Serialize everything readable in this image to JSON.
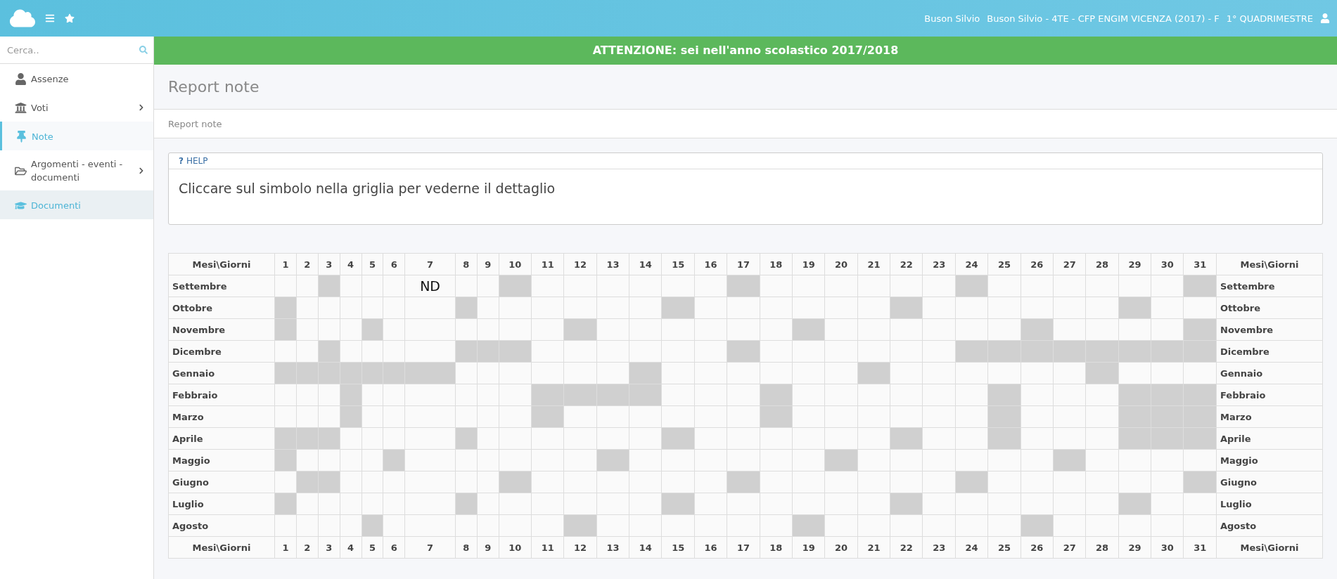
{
  "topbar": {
    "user_name": "Buson Silvio",
    "class_info": "Buson Silvio - 4TE - CFP ENGIM VICENZA (2017) - F",
    "period": "1° QUADRIMESTRE"
  },
  "sidebar": {
    "search": {
      "placeholder": "Cerca.."
    },
    "items": [
      {
        "label": "Assenze",
        "selected": false,
        "has_submenu": false
      },
      {
        "label": "Voti",
        "selected": false,
        "has_submenu": true
      },
      {
        "label": "Note",
        "selected": true,
        "has_submenu": false
      },
      {
        "label": "Argomenti - eventi - documenti",
        "selected": false,
        "has_submenu": true
      },
      {
        "label": "Documenti",
        "selected": false,
        "hovered": true,
        "has_submenu": false
      }
    ]
  },
  "banner": "ATTENZIONE: sei nell'anno scolastico 2017/2018",
  "page_title": "Report note",
  "breadcrumb": "Report note",
  "help": {
    "title": "HELP",
    "icon_text": "?",
    "text": "Cliccare sul simbolo nella griglia per vederne il dettaglio"
  },
  "grid": {
    "header": [
      "Mesi\\Giorni",
      "1",
      "2",
      "3",
      "4",
      "5",
      "6",
      "7",
      "8",
      "9",
      "10",
      "11",
      "12",
      "13",
      "14",
      "15",
      "16",
      "17",
      "18",
      "19",
      "20",
      "21",
      "22",
      "23",
      "24",
      "25",
      "26",
      "27",
      "28",
      "29",
      "30",
      "31",
      "Mesi\\Giorni"
    ],
    "rows": [
      {
        "month_left": "Settembre",
        "month_right": "Settembre",
        "cells": [
          {
            "closed": false
          },
          {
            "closed": false
          },
          {
            "closed": true
          },
          {
            "closed": false
          },
          {
            "closed": false
          },
          {
            "closed": false
          },
          {
            "closed": false,
            "text": "ND"
          },
          {
            "closed": false
          },
          {
            "closed": false
          },
          {
            "closed": true
          },
          {
            "closed": false
          },
          {
            "closed": false
          },
          {
            "closed": false
          },
          {
            "closed": false
          },
          {
            "closed": false
          },
          {
            "closed": false
          },
          {
            "closed": true
          },
          {
            "closed": false
          },
          {
            "closed": false
          },
          {
            "closed": false
          },
          {
            "closed": false
          },
          {
            "closed": false
          },
          {
            "closed": false
          },
          {
            "closed": true
          },
          {
            "closed": false
          },
          {
            "closed": false
          },
          {
            "closed": false
          },
          {
            "closed": false
          },
          {
            "closed": false
          },
          {
            "closed": false
          },
          {
            "closed": true
          }
        ]
      },
      {
        "month_left": "Ottobre",
        "month_right": "Ottobre",
        "cells": [
          {
            "closed": true
          },
          {
            "closed": false
          },
          {
            "closed": false
          },
          {
            "closed": false
          },
          {
            "closed": false
          },
          {
            "closed": false
          },
          {
            "closed": false
          },
          {
            "closed": true
          },
          {
            "closed": false
          },
          {
            "closed": false
          },
          {
            "closed": false
          },
          {
            "closed": false
          },
          {
            "closed": false
          },
          {
            "closed": false
          },
          {
            "closed": true
          },
          {
            "closed": false
          },
          {
            "closed": false
          },
          {
            "closed": false
          },
          {
            "closed": false
          },
          {
            "closed": false
          },
          {
            "closed": false
          },
          {
            "closed": true
          },
          {
            "closed": false
          },
          {
            "closed": false
          },
          {
            "closed": false
          },
          {
            "closed": false
          },
          {
            "closed": false
          },
          {
            "closed": false
          },
          {
            "closed": true
          },
          {
            "closed": false
          },
          {
            "closed": false
          }
        ]
      },
      {
        "month_left": "Novembre",
        "month_right": "Novembre",
        "cells": [
          {
            "closed": true
          },
          {
            "closed": false
          },
          {
            "closed": false
          },
          {
            "closed": false
          },
          {
            "closed": true
          },
          {
            "closed": false
          },
          {
            "closed": false
          },
          {
            "closed": false
          },
          {
            "closed": false
          },
          {
            "closed": false
          },
          {
            "closed": false
          },
          {
            "closed": true
          },
          {
            "closed": false
          },
          {
            "closed": false
          },
          {
            "closed": false
          },
          {
            "closed": false
          },
          {
            "closed": false
          },
          {
            "closed": false
          },
          {
            "closed": true
          },
          {
            "closed": false
          },
          {
            "closed": false
          },
          {
            "closed": false
          },
          {
            "closed": false
          },
          {
            "closed": false
          },
          {
            "closed": false
          },
          {
            "closed": true
          },
          {
            "closed": false
          },
          {
            "closed": false
          },
          {
            "closed": false
          },
          {
            "closed": false
          },
          {
            "closed": true
          }
        ]
      },
      {
        "month_left": "Dicembre",
        "month_right": "Dicembre",
        "cells": [
          {
            "closed": false
          },
          {
            "closed": false
          },
          {
            "closed": true
          },
          {
            "closed": false
          },
          {
            "closed": false
          },
          {
            "closed": false
          },
          {
            "closed": false
          },
          {
            "closed": true
          },
          {
            "closed": true
          },
          {
            "closed": true
          },
          {
            "closed": false
          },
          {
            "closed": false
          },
          {
            "closed": false
          },
          {
            "closed": false
          },
          {
            "closed": false
          },
          {
            "closed": false
          },
          {
            "closed": true
          },
          {
            "closed": false
          },
          {
            "closed": false
          },
          {
            "closed": false
          },
          {
            "closed": false
          },
          {
            "closed": false
          },
          {
            "closed": false
          },
          {
            "closed": true
          },
          {
            "closed": true
          },
          {
            "closed": true
          },
          {
            "closed": true
          },
          {
            "closed": true
          },
          {
            "closed": true
          },
          {
            "closed": true
          },
          {
            "closed": true
          }
        ]
      },
      {
        "month_left": "Gennaio",
        "month_right": "Gennaio",
        "cells": [
          {
            "closed": true
          },
          {
            "closed": true
          },
          {
            "closed": true
          },
          {
            "closed": true
          },
          {
            "closed": true
          },
          {
            "closed": true
          },
          {
            "closed": true
          },
          {
            "closed": false
          },
          {
            "closed": false
          },
          {
            "closed": false
          },
          {
            "closed": false
          },
          {
            "closed": false
          },
          {
            "closed": false
          },
          {
            "closed": true
          },
          {
            "closed": false
          },
          {
            "closed": false
          },
          {
            "closed": false
          },
          {
            "closed": false
          },
          {
            "closed": false
          },
          {
            "closed": false
          },
          {
            "closed": true
          },
          {
            "closed": false
          },
          {
            "closed": false
          },
          {
            "closed": false
          },
          {
            "closed": false
          },
          {
            "closed": false
          },
          {
            "closed": false
          },
          {
            "closed": true
          },
          {
            "closed": false
          },
          {
            "closed": false
          },
          {
            "closed": false
          }
        ]
      },
      {
        "month_left": "Febbraio",
        "month_right": "Febbraio",
        "cells": [
          {
            "closed": false
          },
          {
            "closed": false
          },
          {
            "closed": false
          },
          {
            "closed": true
          },
          {
            "closed": false
          },
          {
            "closed": false
          },
          {
            "closed": false
          },
          {
            "closed": false
          },
          {
            "closed": false
          },
          {
            "closed": false
          },
          {
            "closed": true
          },
          {
            "closed": true
          },
          {
            "closed": true
          },
          {
            "closed": true
          },
          {
            "closed": false
          },
          {
            "closed": false
          },
          {
            "closed": false
          },
          {
            "closed": true
          },
          {
            "closed": false
          },
          {
            "closed": false
          },
          {
            "closed": false
          },
          {
            "closed": false
          },
          {
            "closed": false
          },
          {
            "closed": false
          },
          {
            "closed": true
          },
          {
            "closed": false
          },
          {
            "closed": false
          },
          {
            "closed": false
          },
          {
            "closed": true
          },
          {
            "closed": true
          },
          {
            "closed": true
          }
        ]
      },
      {
        "month_left": "Marzo",
        "month_right": "Marzo",
        "cells": [
          {
            "closed": false
          },
          {
            "closed": false
          },
          {
            "closed": false
          },
          {
            "closed": true
          },
          {
            "closed": false
          },
          {
            "closed": false
          },
          {
            "closed": false
          },
          {
            "closed": false
          },
          {
            "closed": false
          },
          {
            "closed": false
          },
          {
            "closed": true
          },
          {
            "closed": false
          },
          {
            "closed": false
          },
          {
            "closed": false
          },
          {
            "closed": false
          },
          {
            "closed": false
          },
          {
            "closed": false
          },
          {
            "closed": true
          },
          {
            "closed": false
          },
          {
            "closed": false
          },
          {
            "closed": false
          },
          {
            "closed": false
          },
          {
            "closed": false
          },
          {
            "closed": false
          },
          {
            "closed": true
          },
          {
            "closed": false
          },
          {
            "closed": false
          },
          {
            "closed": false
          },
          {
            "closed": true
          },
          {
            "closed": true
          },
          {
            "closed": true
          }
        ]
      },
      {
        "month_left": "Aprile",
        "month_right": "Aprile",
        "cells": [
          {
            "closed": true
          },
          {
            "closed": true
          },
          {
            "closed": true
          },
          {
            "closed": false
          },
          {
            "closed": false
          },
          {
            "closed": false
          },
          {
            "closed": false
          },
          {
            "closed": true
          },
          {
            "closed": false
          },
          {
            "closed": false
          },
          {
            "closed": false
          },
          {
            "closed": false
          },
          {
            "closed": false
          },
          {
            "closed": false
          },
          {
            "closed": true
          },
          {
            "closed": false
          },
          {
            "closed": false
          },
          {
            "closed": false
          },
          {
            "closed": false
          },
          {
            "closed": false
          },
          {
            "closed": false
          },
          {
            "closed": true
          },
          {
            "closed": false
          },
          {
            "closed": false
          },
          {
            "closed": true
          },
          {
            "closed": false
          },
          {
            "closed": false
          },
          {
            "closed": false
          },
          {
            "closed": true
          },
          {
            "closed": true
          },
          {
            "closed": true
          }
        ]
      },
      {
        "month_left": "Maggio",
        "month_right": "Maggio",
        "cells": [
          {
            "closed": true
          },
          {
            "closed": false
          },
          {
            "closed": false
          },
          {
            "closed": false
          },
          {
            "closed": false
          },
          {
            "closed": true
          },
          {
            "closed": false
          },
          {
            "closed": false
          },
          {
            "closed": false
          },
          {
            "closed": false
          },
          {
            "closed": false
          },
          {
            "closed": false
          },
          {
            "closed": true
          },
          {
            "closed": false
          },
          {
            "closed": false
          },
          {
            "closed": false
          },
          {
            "closed": false
          },
          {
            "closed": false
          },
          {
            "closed": false
          },
          {
            "closed": true
          },
          {
            "closed": false
          },
          {
            "closed": false
          },
          {
            "closed": false
          },
          {
            "closed": false
          },
          {
            "closed": false
          },
          {
            "closed": false
          },
          {
            "closed": true
          },
          {
            "closed": false
          },
          {
            "closed": false
          },
          {
            "closed": false
          },
          {
            "closed": false
          }
        ]
      },
      {
        "month_left": "Giugno",
        "month_right": "Giugno",
        "cells": [
          {
            "closed": false
          },
          {
            "closed": true
          },
          {
            "closed": true
          },
          {
            "closed": false
          },
          {
            "closed": false
          },
          {
            "closed": false
          },
          {
            "closed": false
          },
          {
            "closed": false
          },
          {
            "closed": false
          },
          {
            "closed": true
          },
          {
            "closed": false
          },
          {
            "closed": false
          },
          {
            "closed": false
          },
          {
            "closed": false
          },
          {
            "closed": false
          },
          {
            "closed": false
          },
          {
            "closed": true
          },
          {
            "closed": false
          },
          {
            "closed": false
          },
          {
            "closed": false
          },
          {
            "closed": false
          },
          {
            "closed": false
          },
          {
            "closed": false
          },
          {
            "closed": true
          },
          {
            "closed": false
          },
          {
            "closed": false
          },
          {
            "closed": false
          },
          {
            "closed": false
          },
          {
            "closed": false
          },
          {
            "closed": false
          },
          {
            "closed": true
          }
        ]
      },
      {
        "month_left": "Luglio",
        "month_right": "Luglio",
        "cells": [
          {
            "closed": true
          },
          {
            "closed": false
          },
          {
            "closed": false
          },
          {
            "closed": false
          },
          {
            "closed": false
          },
          {
            "closed": false
          },
          {
            "closed": false
          },
          {
            "closed": true
          },
          {
            "closed": false
          },
          {
            "closed": false
          },
          {
            "closed": false
          },
          {
            "closed": false
          },
          {
            "closed": false
          },
          {
            "closed": false
          },
          {
            "closed": true
          },
          {
            "closed": false
          },
          {
            "closed": false
          },
          {
            "closed": false
          },
          {
            "closed": false
          },
          {
            "closed": false
          },
          {
            "closed": false
          },
          {
            "closed": true
          },
          {
            "closed": false
          },
          {
            "closed": false
          },
          {
            "closed": false
          },
          {
            "closed": false
          },
          {
            "closed": false
          },
          {
            "closed": false
          },
          {
            "closed": true
          },
          {
            "closed": false
          },
          {
            "closed": false
          }
        ]
      },
      {
        "month_left": "Agosto",
        "month_right": "Agosto",
        "cells": [
          {
            "closed": false
          },
          {
            "closed": false
          },
          {
            "closed": false
          },
          {
            "closed": false
          },
          {
            "closed": true
          },
          {
            "closed": false
          },
          {
            "closed": false
          },
          {
            "closed": false
          },
          {
            "closed": false
          },
          {
            "closed": false
          },
          {
            "closed": false
          },
          {
            "closed": true
          },
          {
            "closed": false
          },
          {
            "closed": false
          },
          {
            "closed": false
          },
          {
            "closed": false
          },
          {
            "closed": false
          },
          {
            "closed": false
          },
          {
            "closed": true
          },
          {
            "closed": false
          },
          {
            "closed": false
          },
          {
            "closed": false
          },
          {
            "closed": false
          },
          {
            "closed": false
          },
          {
            "closed": false
          },
          {
            "closed": true
          },
          {
            "closed": false
          },
          {
            "closed": false
          },
          {
            "closed": false
          },
          {
            "closed": false
          },
          {
            "closed": false
          }
        ]
      }
    ],
    "footer": [
      "Mesi\\Giorni",
      "1",
      "2",
      "3",
      "4",
      "5",
      "6",
      "7",
      "8",
      "9",
      "10",
      "11",
      "12",
      "13",
      "14",
      "15",
      "16",
      "17",
      "18",
      "19",
      "20",
      "21",
      "22",
      "23",
      "24",
      "25",
      "26",
      "27",
      "28",
      "29",
      "30",
      "31",
      "Mesi\\Giorni"
    ]
  }
}
